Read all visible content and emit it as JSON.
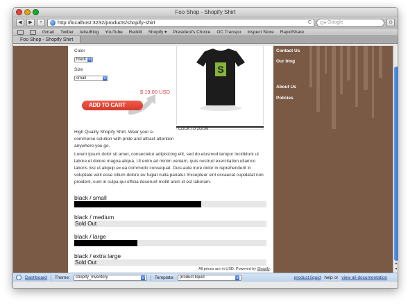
{
  "window": {
    "title": "Foo Shop - Shopify Shirt"
  },
  "toolbar": {
    "back": "◀",
    "forward": "▶",
    "add": "+",
    "url": "http://localhost:3232/products/shopify-shirt",
    "reload": "C",
    "search_placeholder": "Google",
    "menu": "⊙"
  },
  "bookmarks": [
    "Gmail",
    "Twitter",
    "tetsuBlog",
    "YouTube",
    "Reddit",
    "Shopify ▾",
    "President's Choice",
    "OC Transpo",
    "Inspect Store",
    "RapidShare"
  ],
  "tab": {
    "label": "Foo Shop - Shopify Shirt"
  },
  "product": {
    "color_label": "Color",
    "color_value": "black",
    "size_label": "Size",
    "size_value": "small",
    "price": "$ 19.00 USD",
    "add_to_cart": "ADD TO CART",
    "zoom": "CLICK TO ZOOM",
    "description": "High Quality Shopify Shirt. Wear your e-commerce solution with pride and attract attention anywhere you go.",
    "lorem": "Lorem ipsum dolor sit amet, consectetur adipisicing elit, sed do eiusmod tempor incididunt ut labore et dolore magna aliqua. Ut enim ad minim veniam, quis nostrud exercitation ullamco laboris nisi ut aliquip ex ea commodo consequat. Duis aute irure dolor in reprehenderit in voluptate velit esse cillum dolore eu fugiat nulla pariatur. Excepteur sint occaecat cupidatat non proident, sunt in culpa qui officia deserunt mollit anim id est laborum.",
    "tshirt_logo": "S"
  },
  "variants": [
    {
      "name": "black / small",
      "stock_fraction": 0.66,
      "status": ""
    },
    {
      "name": "black / medium",
      "stock_fraction": 0,
      "status": "Sold Out"
    },
    {
      "name": "black / large",
      "stock_fraction": 0.33,
      "status": ""
    },
    {
      "name": "black / extra large",
      "stock_fraction": 0,
      "status": "Sold Out"
    }
  ],
  "footer": {
    "note": "All prices are in USD. Powered by",
    "powered_link": "Shopify",
    "period": "."
  },
  "sidebar": {
    "links": [
      "Contact Us",
      "Our blog",
      "About Us",
      "Policies"
    ]
  },
  "themebar": {
    "dashboard": "Dashboard",
    "theme_label": "Theme:",
    "theme_value": "shopify_inventory",
    "template_label": "Template:",
    "template_value": "product.liquid",
    "file_link": "product.liquid",
    "help_text": "help or",
    "docs_link": "view all documentation"
  },
  "colors": {
    "accent_red": "#d43c3c",
    "sidebar_brown": "#7a5a45",
    "button_red": "#e04a3b"
  }
}
